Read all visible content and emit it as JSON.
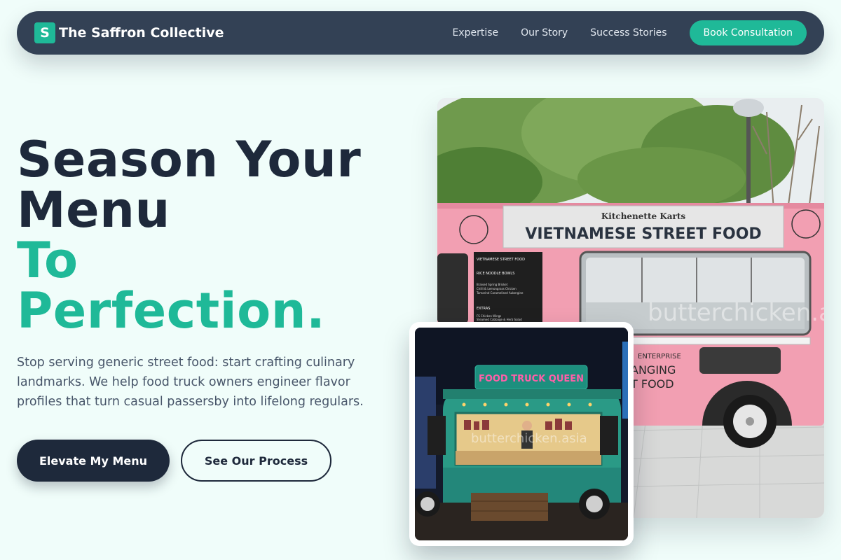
{
  "brand": {
    "logo_letter": "S",
    "name": "The Saffron Collective"
  },
  "nav": {
    "links": [
      "Expertise",
      "Our Story",
      "Success Stories"
    ],
    "cta": "Book Consultation"
  },
  "hero": {
    "title_line1": "Season Your",
    "title_line2": "Menu",
    "title_accent1": "To",
    "title_accent2": "Perfection.",
    "subtitle": "Stop serving generic street food: start crafting culinary landmarks. We help food truck owners engineer flavor profiles that turn casual passersby into lifelong regulars.",
    "primary_button": "Elevate My Menu",
    "secondary_button": "See Our Process"
  },
  "images": {
    "main": {
      "sign_small": "Kitchenette Karts",
      "sign_main": "VIETNAMESE STREET FOOD",
      "side_text_1": "ENTERPRISE",
      "side_text_2": "ANGING",
      "side_text_3": "T FOOD",
      "menu_board": {
        "heading": "VIETNAMESE STREET FOOD",
        "section1": "RICE NOODLE BOWLS",
        "items1": [
          "Braised Spring Brisket",
          "Chilli & Lemongrass Chicken",
          "Tamarind Caramelised Aubergine"
        ],
        "section2": "EXTRAS",
        "items2": [
          "FS Chicken Wings",
          "Steamed Cabbage & Herb Salad"
        ]
      },
      "watermark": "butterchicken.asia"
    },
    "second": {
      "sign": "FOOD TRUCK QUEEN",
      "watermark": "butterchicken.asia"
    }
  },
  "colors": {
    "accent": "#1fb998",
    "dark": "#1e293b",
    "nav_bg": "#334155",
    "page_bg": "#f0fdfa"
  }
}
